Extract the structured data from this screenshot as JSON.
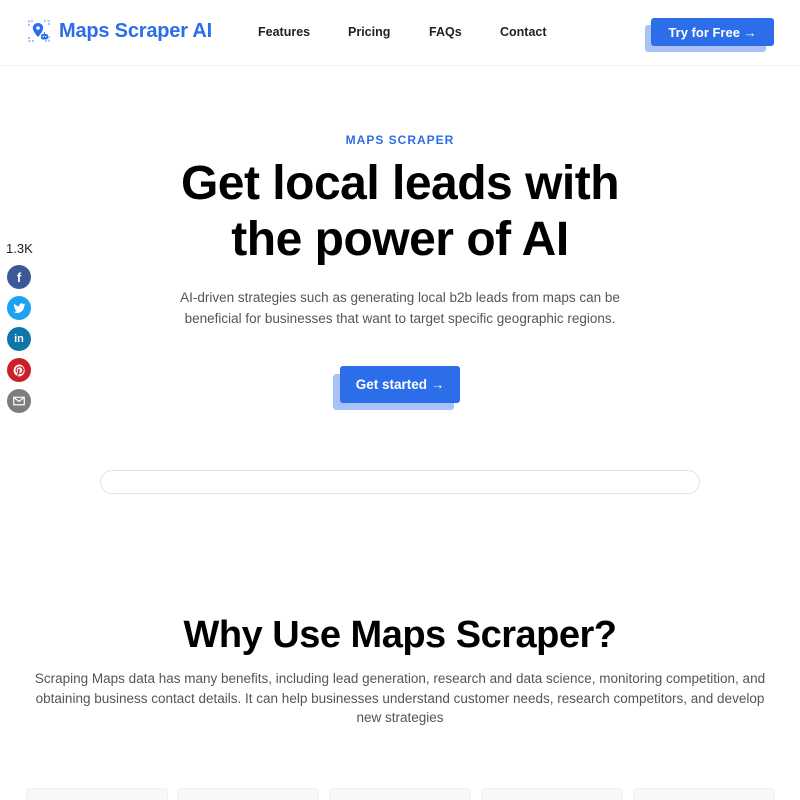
{
  "header": {
    "brand": "Maps Scraper AI",
    "logo_icon": "map-pin-robot-icon",
    "nav": [
      {
        "label": "Features"
      },
      {
        "label": "Pricing"
      },
      {
        "label": "FAQs"
      },
      {
        "label": "Contact"
      }
    ],
    "cta_label": "Try for Free →"
  },
  "share": {
    "count": "1.3K",
    "buttons": [
      {
        "name": "facebook",
        "icon": "facebook-icon",
        "glyph": "f",
        "color": "#3b5998"
      },
      {
        "name": "twitter",
        "icon": "twitter-icon",
        "glyph": "t",
        "color": "#1da1f2"
      },
      {
        "name": "linkedin",
        "icon": "linkedin-icon",
        "glyph": "in",
        "color": "#0e76a8"
      },
      {
        "name": "pinterest",
        "icon": "pinterest-icon",
        "glyph": "p",
        "color": "#cb2027"
      },
      {
        "name": "email",
        "icon": "email-icon",
        "glyph": "✉",
        "color": "#7d7d7d"
      }
    ]
  },
  "hero": {
    "eyebrow": "MAPS SCRAPER",
    "title_line1": "Get local leads with",
    "title_line2": "the power of AI",
    "subtitle": "AI-driven strategies such as generating local b2b leads from maps can be beneficial for businesses that want to target specific geographic regions.",
    "button_label": "Get started →",
    "search_placeholder": ""
  },
  "why": {
    "title": "Why Use Maps Scraper?",
    "description": "Scraping Maps data has many benefits, including lead generation, research and data science, monitoring competition, and obtaining business contact details. It can help businesses understand customer needs, research competitors, and develop new strategies"
  },
  "colors": {
    "accent": "#2c6ee9",
    "accent_shadow": "#a9c2f5",
    "text_muted": "#555555"
  }
}
